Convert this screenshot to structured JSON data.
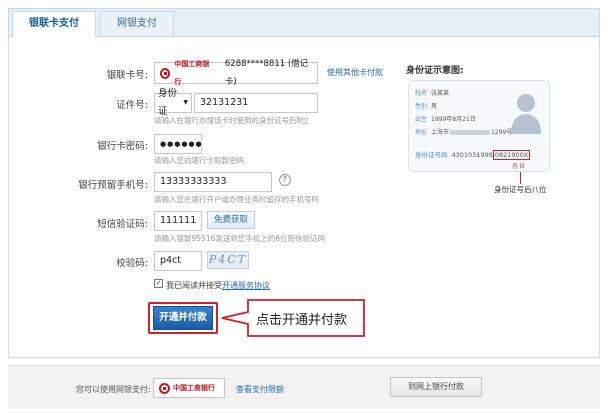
{
  "tabs": [
    {
      "label": "银联卡支付"
    },
    {
      "label": "网银支付"
    }
  ],
  "form": {
    "card_label": "银联卡号:",
    "bank_name": "中国工商银行",
    "card_number": "6288****8811 (借记卡)",
    "other_card_link": "使用其他卡付款",
    "id_label": "证件号:",
    "id_type": "身份证",
    "id_value": "32131231",
    "id_hint": "请输入在银行办理该卡时使用的身份证号后8位",
    "pwd_label": "银行卡密码:",
    "pwd_value": "●●●●●●",
    "pwd_hint": "请输入您的银行卡取款密码",
    "phone_label": "银行预留手机号:",
    "phone_value": "13333333333",
    "phone_help": "?",
    "phone_hint": "请输入您在银行开户或办理业务时留存的手机号码",
    "sms_label": "短信验证码:",
    "sms_value": "111111",
    "sms_button": "免费获取",
    "sms_hint": "请输入银联95516发送到您手机上的6位短信验证码",
    "captcha_label": "校验码:",
    "captcha_value": "p4ct",
    "captcha_image_text": "P4CT",
    "agree_text": "我已阅读并接受",
    "agree_link": "开通服务协议",
    "submit_button": "开通并付款",
    "callout_text": "点击开通并付款"
  },
  "id_illustration": {
    "title": "身份证示意图:",
    "name_key": "姓名",
    "name_val": "张某某",
    "sex_key": "性别",
    "sex_val": "男",
    "birth_key": "出生",
    "birth_val": "1999年8月21日",
    "addr_key": "地址",
    "addr_val": "上海市",
    "addr_suffix": "1299号",
    "num_key": "身份证号码",
    "num_val": "43010319990821900X",
    "num_prefix": "4301031999",
    "num_highlight": "0821900X",
    "month_day": "月 日",
    "caption": "身份证号后八位"
  },
  "bottom": {
    "label": "您可以使用网银支付:",
    "bank_name": "中国工商银行",
    "limit_link": "查看支付限额",
    "goto_button": "到网上银行付款"
  }
}
